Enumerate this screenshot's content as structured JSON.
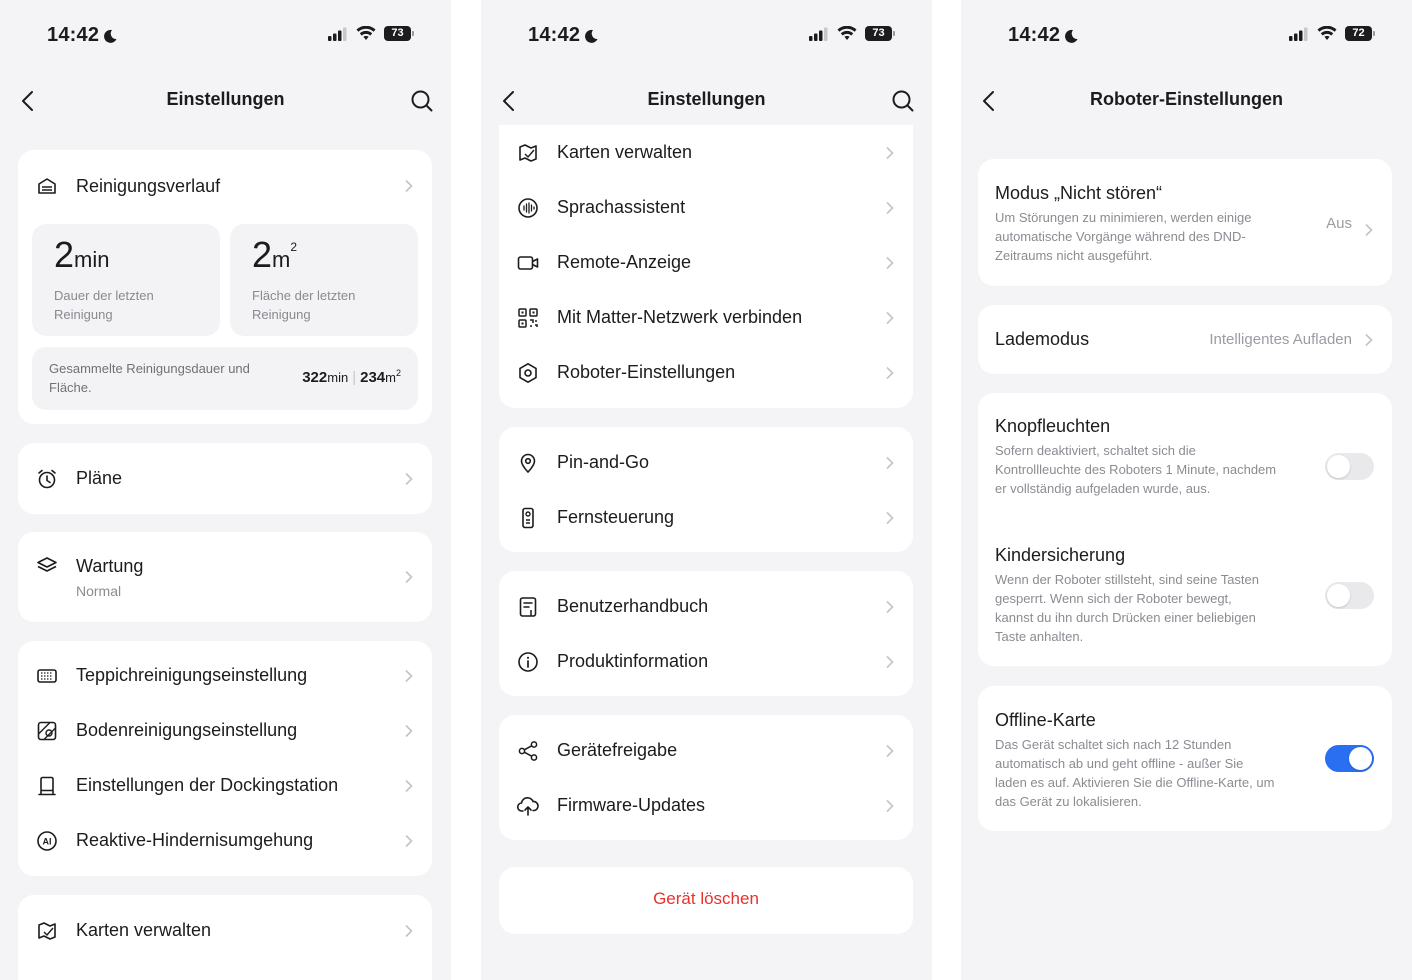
{
  "colors": {
    "accent": "#2a6ef2",
    "danger": "#e5322d",
    "background": "#f4f4f6",
    "card": "#ffffff"
  },
  "status": {
    "time": "14:42",
    "battery_1": "73",
    "battery_2": "73",
    "battery_3": "72"
  },
  "screen1": {
    "title": "Einstellungen",
    "history": {
      "label": "Reinigungsverlauf",
      "last_duration_value": "2",
      "last_duration_unit": "min",
      "last_duration_label": "Dauer der letzten Reinigung",
      "last_area_value": "2",
      "last_area_unit": "m",
      "last_area_sup": "2",
      "last_area_label": "Fläche der letzten Reinigung",
      "total_label": "Gesammelte Reinigungsdauer und Fläche.",
      "total_duration_value": "322",
      "total_duration_unit": "min",
      "total_area_value": "234",
      "total_area_unit": "m",
      "total_area_sup": "2"
    },
    "plans_label": "Pläne",
    "maintenance_label": "Wartung",
    "maintenance_value": "Normal",
    "group3": [
      {
        "label": "Teppichreinigungseinstellung",
        "icon": "carpet-icon"
      },
      {
        "label": "Bodenreinigungseinstellung",
        "icon": "floor-icon"
      },
      {
        "label": "Einstellungen der Dockingstation",
        "icon": "dock-icon"
      },
      {
        "label": "Reaktive-Hindernisumgehung",
        "icon": "ai-icon"
      }
    ],
    "map_label": "Karten verwalten"
  },
  "screen2": {
    "title": "Einstellungen",
    "group1": [
      {
        "label": "Karten verwalten",
        "icon": "map-icon"
      },
      {
        "label": "Sprachassistent",
        "icon": "voice-icon"
      },
      {
        "label": "Remote-Anzeige",
        "icon": "camera-icon"
      },
      {
        "label": "Mit Matter-Netzwerk verbinden",
        "icon": "qr-icon"
      },
      {
        "label": "Roboter-Einstellungen",
        "icon": "robot-icon"
      }
    ],
    "group2": [
      {
        "label": "Pin-and-Go",
        "icon": "pin-icon"
      },
      {
        "label": "Fernsteuerung",
        "icon": "remote-icon"
      }
    ],
    "group3": [
      {
        "label": "Benutzerhandbuch",
        "icon": "manual-icon"
      },
      {
        "label": "Produktinformation",
        "icon": "info-icon"
      }
    ],
    "group4": [
      {
        "label": "Gerätefreigabe",
        "icon": "share-icon"
      },
      {
        "label": "Firmware-Updates",
        "icon": "cloud-upload-icon"
      }
    ],
    "delete_label": "Gerät löschen"
  },
  "screen3": {
    "title": "Roboter-Einstellungen",
    "dnd": {
      "title": "Modus „Nicht stören“",
      "desc": "Um Störungen zu minimieren, werden einige automatische Vorgänge während des DND-Zeitraums nicht ausgeführt.",
      "value": "Aus"
    },
    "charge": {
      "title": "Lademodus",
      "value": "Intelligentes Aufladen"
    },
    "button_light": {
      "title": "Knopfleuchten",
      "desc": "Sofern deaktiviert, schaltet sich die Kontrollleuchte des Roboters 1 Minute, nachdem er vollständig aufgeladen wurde, aus.",
      "enabled": false
    },
    "child_lock": {
      "title": "Kindersicherung",
      "desc": "Wenn der Roboter stillsteht, sind seine Tasten gesperrt. Wenn sich der Roboter bewegt, kannst du ihn durch Drücken einer beliebigen Taste anhalten.",
      "enabled": false
    },
    "offline_map": {
      "title": "Offline-Karte",
      "desc": "Das Gerät schaltet sich nach 12 Stunden automatisch ab und geht offline - außer Sie laden es auf. Aktivieren Sie die Offline-Karte, um das Gerät zu lokalisieren.",
      "enabled": true
    }
  }
}
